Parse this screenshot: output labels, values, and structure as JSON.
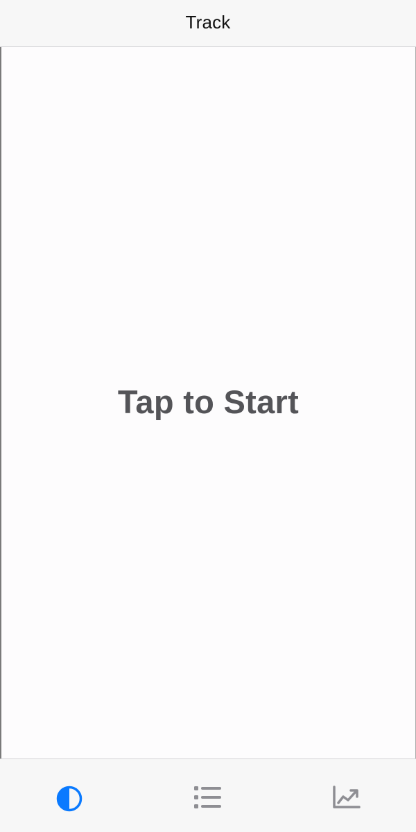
{
  "header": {
    "title": "Track"
  },
  "main": {
    "start_label": "Tap to Start"
  },
  "tab_bar": {
    "tabs": [
      {
        "icon": "half-circle-icon",
        "selected": true
      },
      {
        "icon": "list-icon",
        "selected": false
      },
      {
        "icon": "chart-trend-icon",
        "selected": false
      }
    ]
  },
  "colors": {
    "accent": "#0a7aff",
    "tab_inactive": "#8e8e93",
    "start_text": "#545458"
  }
}
